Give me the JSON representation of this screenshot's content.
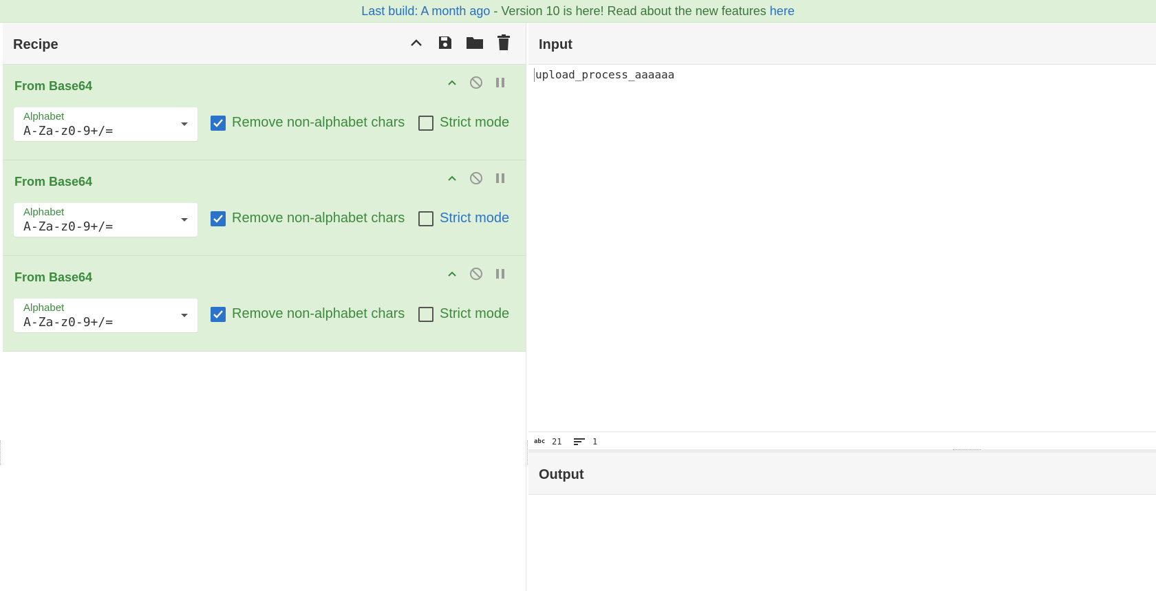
{
  "banner": {
    "prefix": "Last build: A month ago",
    "middle": " - Version 10 is here! Read about the new features ",
    "link": "here"
  },
  "recipe": {
    "title": "Recipe",
    "operations": [
      {
        "title": "From Base64",
        "alphabet_label": "Alphabet",
        "alphabet_value": "A-Za-z0-9+/=",
        "remove_label": "Remove non-alphabet chars",
        "remove_checked": true,
        "strict_label": "Strict mode",
        "strict_checked": false
      },
      {
        "title": "From Base64",
        "alphabet_label": "Alphabet",
        "alphabet_value": "A-Za-z0-9+/=",
        "remove_label": "Remove non-alphabet chars",
        "remove_checked": true,
        "strict_label": "Strict mode",
        "strict_checked": false
      },
      {
        "title": "From Base64",
        "alphabet_label": "Alphabet",
        "alphabet_value": "A-Za-z0-9+/=",
        "remove_label": "Remove non-alphabet chars",
        "remove_checked": true,
        "strict_label": "Strict mode",
        "strict_checked": false
      }
    ]
  },
  "input": {
    "title": "Input",
    "text": "upload_process_aaaaaa",
    "status_chars_icon": "abc",
    "status_chars": "21",
    "status_lines": "1"
  },
  "output": {
    "title": "Output"
  },
  "colors": {
    "banner_bg": "#dff0d8",
    "operation_bg": "#dff0d8",
    "accent_green": "#3c8a3d",
    "checkbox_blue": "#2a73c9"
  },
  "icons": [
    "chevron-up-icon",
    "save-icon",
    "folder-icon",
    "trash-icon",
    "disable-icon",
    "pause-icon",
    "text-lines-icon"
  ]
}
